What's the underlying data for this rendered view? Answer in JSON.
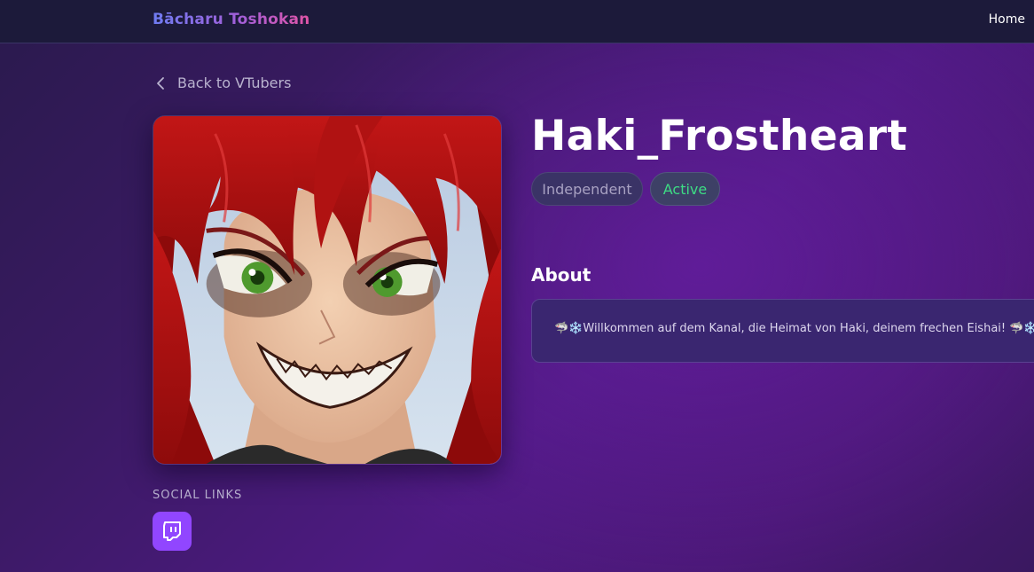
{
  "nav": {
    "brand": "Bācharu Toshokan",
    "home_label": "Home"
  },
  "back_link": {
    "label": "Back to VTubers"
  },
  "profile": {
    "name": "Haki_Frostheart",
    "affiliation": "Independent",
    "status": "Active",
    "status_color": "#3ddc84"
  },
  "social": {
    "title": "SOCIAL LINKS",
    "links": [
      {
        "platform": "twitch",
        "icon": "twitch-icon",
        "color": "#9146ff"
      }
    ]
  },
  "about": {
    "title": "About",
    "text": "🦈❄️Willkommen auf dem Kanal, die Heimat von Haki, deinem frechen Eishai! 🦈❄️"
  },
  "colors": {
    "nav_bg": "#1c1a3a",
    "accent_gradient": [
      "#6f7cf2",
      "#e054a6"
    ],
    "twitch": "#9146ff"
  }
}
